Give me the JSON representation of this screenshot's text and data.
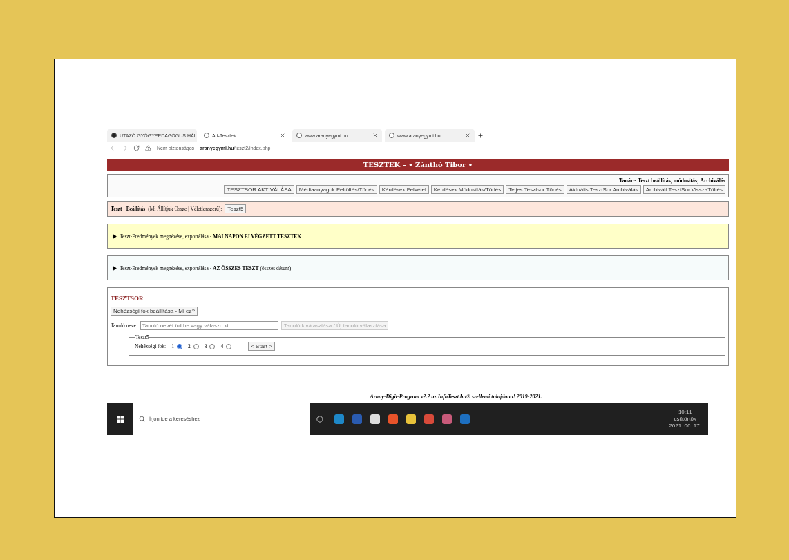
{
  "browser": {
    "tabs": [
      {
        "title": "UTAZÓ GYÓGYPEDAGÓGUS HÁL",
        "selected": false
      },
      {
        "title": "A.t-Tesztek",
        "selected": true
      },
      {
        "title": "www.aranyegymi.hu",
        "selected": false
      },
      {
        "title": "www.aranyegymi.hu",
        "selected": false
      }
    ],
    "security": "Nem biztonságos",
    "url_host": "aranyegymi.hu",
    "url_path": "/teszt2/index.php"
  },
  "header": {
    "title": "TESZTEK – • Zánthó Tibor •"
  },
  "teacher_panel": {
    "title": "Tanár - Teszt beállítás, módosítás; Archiválás",
    "buttons": [
      "TESZTSOR AKTIVÁLÁSA",
      "Médiaanyagok Feltöltés/Törlés",
      "Kérdések Felvétel",
      "Kérdések Módosítás/Törlés",
      "Teljes Tesztsor Törlés",
      "Aktuális TesztSor Archiválás",
      "Archivált TesztSor VisszaTöltés"
    ]
  },
  "settings": {
    "label": "Teszt - Beállítás",
    "note": "(Mi Állítjuk Össze | Véletlenszerű):",
    "button": "Teszt5"
  },
  "results": [
    {
      "text": "Teszt-Eredmények megnézése, exportálása - **MAI NAPON ELVÉGZETT TESZTEK**",
      "expanded": false,
      "color": "#ffffc8"
    },
    {
      "text": "Teszt-Eredmények megnézése, exportálása - **AZ ÖSSZES TESZT** (összes dátum)",
      "expanded": false,
      "color": "#f6fbfb"
    }
  ],
  "test_series": {
    "title": "TESZTSOR",
    "difficulty_button": "Nehézségi fok beállítása - Mi ez?",
    "student_label": "Tanuló neve:",
    "student_placeholder": "Tanuló nevét írd be vagy válaszd ki!",
    "student_button": "Tanuló kiválasztása / Új tanuló választása",
    "student_button_disabled": true,
    "fieldset": {
      "legend": "Teszt5",
      "label": "Nehézségi fok:",
      "levels": [
        {
          "label": "1",
          "selected": true
        },
        {
          "label": "2",
          "selected": false
        },
        {
          "label": "3",
          "selected": false
        },
        {
          "label": "4",
          "selected": false
        }
      ],
      "start": "< Start >"
    }
  },
  "footer": "Arany-Digit-Program v2.2 az InfoTeszt.hu® szellemi tulajdona!   2019-2021.",
  "taskbar": {
    "search_placeholder": "Írjon ide a kereséshez",
    "time": "10:11",
    "day": "csütörtök",
    "date": "2021. 06. 17."
  }
}
